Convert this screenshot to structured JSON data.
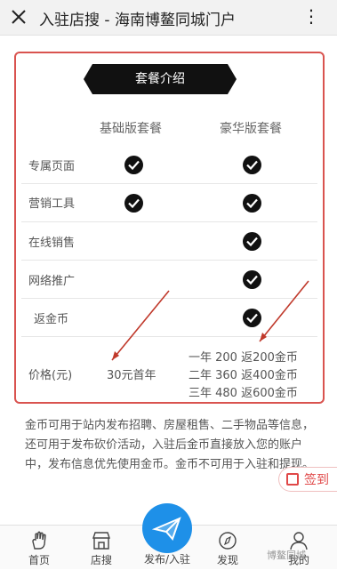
{
  "header": {
    "title": "入驻店搜 - 海南博鳌同城门户",
    "more": "⋮"
  },
  "banner": "套餐介绍",
  "columns": {
    "basic": "基础版套餐",
    "luxury": "豪华版套餐"
  },
  "features": [
    {
      "label": "专属页面",
      "basic": true,
      "luxury": true
    },
    {
      "label": "营销工具",
      "basic": true,
      "luxury": true
    },
    {
      "label": "在线销售",
      "basic": false,
      "luxury": true
    },
    {
      "label": "网络推广",
      "basic": false,
      "luxury": true
    },
    {
      "label": "返金币",
      "basic": false,
      "luxury": true
    }
  ],
  "price": {
    "label": "价格(元)",
    "basic": "30元首年",
    "luxury": [
      "一年 200 返200金币",
      "二年 360 返400金币",
      "三年 480 返600金币"
    ]
  },
  "description": "金币可用于站内发布招聘、房屋租售、二手物品等信息，还可用于发布砍价活动，入驻后金币直接放入您的账户中，发布信息优先使用金币。金币不可用于入驻和提现。",
  "checkin": "签到",
  "nav": {
    "home": "首页",
    "shop": "店搜",
    "publish": "发布/入驻",
    "discover": "发现",
    "mine": "我的"
  },
  "watermark": "博鳌同城",
  "colors": {
    "accent": "#d9534f",
    "publish": "#1e90e8"
  }
}
